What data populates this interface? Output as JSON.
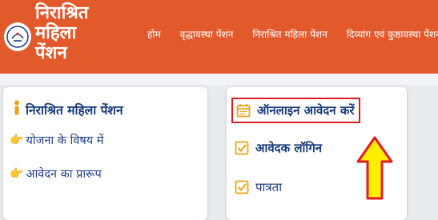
{
  "header": {
    "title_lines": [
      "निराश्रित",
      "महिला",
      "पेंशन"
    ],
    "logo_icon": "up-government-emblem-icon",
    "background": "#e2592c"
  },
  "nav": {
    "items": [
      "होम",
      "वृद्धावस्था पेंशन",
      "निराश्रित महिला पेंशन",
      "दिव्यांग एवं कुष्ठावस्था पेंशन"
    ]
  },
  "left_card": {
    "heading": "निराश्रित महिला पेंशन",
    "heading_icon": "person-icon",
    "links": [
      {
        "label": "योजना के विषय में",
        "icon": "pointing-hand-icon"
      },
      {
        "label": "आवेदन का प्रारूप",
        "icon": "pointing-hand-icon"
      }
    ]
  },
  "right_card": {
    "links": [
      {
        "label": "ऑनलाइन आवेदन करें",
        "icon": "calendar-icon"
      },
      {
        "label": "आवेदक लॉगिन",
        "icon": "checkbox-icon"
      },
      {
        "label": "पात्रता",
        "icon": "checkbox-icon"
      }
    ]
  },
  "colors": {
    "accent": "#e2592c",
    "link": "#163a7c",
    "highlight_border": "#e01b24",
    "arrow_fill": "#ffee00"
  }
}
